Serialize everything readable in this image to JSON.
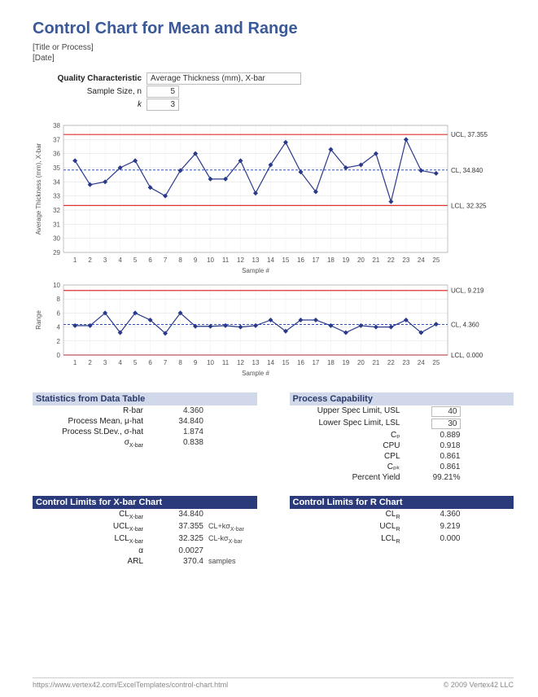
{
  "header": {
    "title": "Control Chart for Mean and Range",
    "subtitle1": "[Title or Process]",
    "subtitle2": "[Date]"
  },
  "qc": {
    "label": "Quality Characteristic",
    "value": "Average Thickness (mm), X-bar",
    "size_label": "Sample Size, n",
    "size_value": "5",
    "k_label": "k",
    "k_value": "3"
  },
  "chart_data": [
    {
      "type": "line",
      "title": "X-bar Chart",
      "xlabel": "Sample #",
      "ylabel": "Average Thickness (mm), X-bar",
      "categories": [
        "1",
        "2",
        "3",
        "4",
        "5",
        "6",
        "7",
        "8",
        "9",
        "10",
        "11",
        "12",
        "13",
        "14",
        "15",
        "16",
        "17",
        "18",
        "19",
        "20",
        "21",
        "22",
        "23",
        "24",
        "25"
      ],
      "values": [
        35.5,
        33.8,
        34.0,
        35.0,
        35.5,
        33.6,
        33.0,
        34.8,
        36.0,
        34.2,
        34.2,
        35.5,
        33.2,
        35.2,
        36.8,
        34.7,
        33.3,
        36.3,
        35.0,
        35.2,
        36.0,
        32.6,
        37.0,
        34.8,
        34.6
      ],
      "ylim": [
        29,
        38
      ],
      "yticks": [
        29,
        30,
        31,
        32,
        33,
        34,
        35,
        36,
        37,
        38
      ],
      "ucl": 37.355,
      "cl": 34.84,
      "lcl": 32.325,
      "ucl_label": "UCL, 37.355",
      "cl_label": "CL, 34.840",
      "lcl_label": "LCL, 32.325"
    },
    {
      "type": "line",
      "title": "R Chart",
      "xlabel": "Sample #",
      "ylabel": "Range",
      "categories": [
        "1",
        "2",
        "3",
        "4",
        "5",
        "6",
        "7",
        "8",
        "9",
        "10",
        "11",
        "12",
        "13",
        "14",
        "15",
        "16",
        "17",
        "18",
        "19",
        "20",
        "21",
        "22",
        "23",
        "24",
        "25"
      ],
      "values": [
        4.2,
        4.2,
        6.0,
        3.2,
        6.0,
        5.0,
        3.1,
        6.0,
        4.1,
        4.1,
        4.2,
        4.0,
        4.2,
        5.0,
        3.4,
        5.0,
        5.0,
        4.2,
        3.2,
        4.2,
        4.0,
        4.0,
        5.0,
        3.2,
        4.4
      ],
      "ylim": [
        0,
        10
      ],
      "yticks": [
        0,
        2,
        4,
        6,
        8,
        10
      ],
      "ucl": 9.219,
      "cl": 4.36,
      "lcl": 0.0,
      "ucl_label": "UCL, 9.219",
      "cl_label": "CL, 4.360",
      "lcl_label": "LCL, 0.000"
    }
  ],
  "stats": {
    "header": "Statistics from Data Table",
    "rbar_label": "R-bar",
    "rbar": "4.360",
    "pmean_label": "Process Mean, μ-hat",
    "pmean": "34.840",
    "psd_label": "Process St.Dev., σ-hat",
    "psd": "1.874",
    "sx_label": "σ",
    "sx_sub": "X-bar",
    "sx": "0.838"
  },
  "pc": {
    "header": "Process Capability",
    "usl_label": "Upper Spec Limit, USL",
    "usl": "40",
    "lsl_label": "Lower Spec Limit, LSL",
    "lsl": "30",
    "cp_label": "Cₚ",
    "cp": "0.889",
    "cpu_label": "CPU",
    "cpu": "0.918",
    "cpl_label": "CPL",
    "cpl": "0.861",
    "cpk_label": "Cₚₖ",
    "cpk": "0.861",
    "py_label": "Percent Yield",
    "py": "99.21%"
  },
  "cl_xbar": {
    "header": "Control Limits for X-bar Chart",
    "cl_label": "CL",
    "cl_sub": "X-bar",
    "cl": "34.840",
    "ucl_label": "UCL",
    "ucl": "37.355",
    "ucl_extra": "CL+kσ",
    "lcl_label": "LCL",
    "lcl": "32.325",
    "lcl_extra": "CL-kσ",
    "alpha_label": "α",
    "alpha": "0.0027",
    "arl_label": "ARL",
    "arl": "370.4",
    "arl_extra": "samples"
  },
  "cl_r": {
    "header": "Control Limits for R Chart",
    "cl_label": "CL",
    "cl_sub": "R",
    "cl": "4.360",
    "ucl_label": "UCL",
    "ucl": "9.219",
    "lcl_label": "LCL",
    "lcl": "0.000"
  },
  "footer": {
    "left": "https://www.vertex42.com/ExcelTemplates/control-chart.html",
    "right": "© 2009 Vertex42 LLC"
  }
}
